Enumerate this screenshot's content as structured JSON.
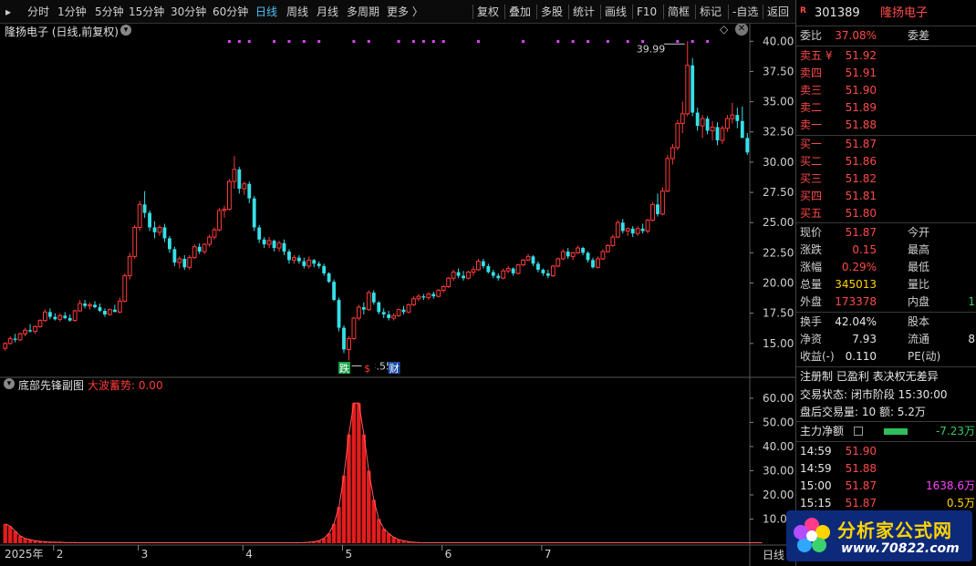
{
  "toolbar": {
    "left": [
      "分时",
      "1分钟",
      "5分钟",
      "15分钟",
      "30分钟",
      "60分钟",
      "日线",
      "周线",
      "月线",
      "多周期",
      "更多 〉"
    ],
    "active": "日线",
    "right": [
      "复权",
      "叠加",
      "多股",
      "统计",
      "画线",
      "F10",
      "简框",
      "标记",
      "-自选",
      "返回"
    ]
  },
  "chart": {
    "title": "隆扬电子 (日线,前复权)",
    "high_label": "39.99",
    "low_label": "13.55",
    "markers": [
      "跌",
      "$",
      "财"
    ],
    "price_ticks": [
      "40.00",
      "37.50",
      "35.00",
      "32.50",
      "30.00",
      "27.50",
      "25.00",
      "22.50",
      "20.00",
      "17.50",
      "15.00"
    ],
    "date_labels": [
      "2025年",
      "2",
      "3",
      "4",
      "5",
      "6",
      "7"
    ],
    "period_label": "日线"
  },
  "sub": {
    "title": "底部先锋副图",
    "series_label": "大波蓄势: 0.00",
    "ticks": [
      "60.00",
      "50.00",
      "40.00",
      "30.00",
      "20.00",
      "10.00"
    ]
  },
  "colors": {
    "up": "#ff3b3b",
    "down": "#35e0e8",
    "grid": "#3a1a1a",
    "bar": "#e41c1c",
    "dot": "#e040fb"
  },
  "chart_data": {
    "type": "candlestick",
    "ylim": [
      12.5,
      41
    ],
    "sub_ylim": [
      0,
      66
    ],
    "candles": [
      [
        14.6,
        15.1,
        14.4,
        15.0
      ],
      [
        15.0,
        15.6,
        14.9,
        15.4
      ],
      [
        15.4,
        15.8,
        15.1,
        15.3
      ],
      [
        15.3,
        15.9,
        15.2,
        15.8
      ],
      [
        15.8,
        16.3,
        15.6,
        16.1
      ],
      [
        16.1,
        16.6,
        15.9,
        16.0
      ],
      [
        16.0,
        16.5,
        15.8,
        16.4
      ],
      [
        16.4,
        17.0,
        16.3,
        16.9
      ],
      [
        16.9,
        17.8,
        16.8,
        17.6
      ],
      [
        17.6,
        17.9,
        17.0,
        17.2
      ],
      [
        17.2,
        17.5,
        16.9,
        17.0
      ],
      [
        17.0,
        17.5,
        16.8,
        17.3
      ],
      [
        17.3,
        17.6,
        17.0,
        17.1
      ],
      [
        17.1,
        17.4,
        16.8,
        16.9
      ],
      [
        16.9,
        17.8,
        16.8,
        17.7
      ],
      [
        17.7,
        18.6,
        17.6,
        18.3
      ],
      [
        18.3,
        18.6,
        17.9,
        18.1
      ],
      [
        18.1,
        18.4,
        17.8,
        18.2
      ],
      [
        18.2,
        18.5,
        17.9,
        18.0
      ],
      [
        18.0,
        18.3,
        17.6,
        17.7
      ],
      [
        17.7,
        17.9,
        17.2,
        17.4
      ],
      [
        17.4,
        17.9,
        17.3,
        17.8
      ],
      [
        17.8,
        18.2,
        17.6,
        17.6
      ],
      [
        17.6,
        18.8,
        17.5,
        18.5
      ],
      [
        18.5,
        20.8,
        18.4,
        20.6
      ],
      [
        20.6,
        22.5,
        20.3,
        22.2
      ],
      [
        22.2,
        24.8,
        22.0,
        24.6
      ],
      [
        24.6,
        26.8,
        24.3,
        26.5
      ],
      [
        26.5,
        27.6,
        25.4,
        25.8
      ],
      [
        25.8,
        26.0,
        24.3,
        24.6
      ],
      [
        24.6,
        25.1,
        23.7,
        24.2
      ],
      [
        24.2,
        24.8,
        23.9,
        24.6
      ],
      [
        24.6,
        24.9,
        23.4,
        23.7
      ],
      [
        23.7,
        23.9,
        22.5,
        22.8
      ],
      [
        22.8,
        23.0,
        21.4,
        21.7
      ],
      [
        21.7,
        22.2,
        21.2,
        22.0
      ],
      [
        22.0,
        22.3,
        21.1,
        21.3
      ],
      [
        21.3,
        22.3,
        21.1,
        22.1
      ],
      [
        22.1,
        23.2,
        22.0,
        23.0
      ],
      [
        23.0,
        23.3,
        22.4,
        22.6
      ],
      [
        22.6,
        23.3,
        22.4,
        23.2
      ],
      [
        23.2,
        24.0,
        23.0,
        23.8
      ],
      [
        23.8,
        24.6,
        23.6,
        24.4
      ],
      [
        24.4,
        26.2,
        24.3,
        26.0
      ],
      [
        26.0,
        26.4,
        25.4,
        26.1
      ],
      [
        26.1,
        28.6,
        26.0,
        28.4
      ],
      [
        28.4,
        30.5,
        27.8,
        29.4
      ],
      [
        29.4,
        29.6,
        27.4,
        27.8
      ],
      [
        27.8,
        28.4,
        27.3,
        28.2
      ],
      [
        28.2,
        28.4,
        26.6,
        27.0
      ],
      [
        27.0,
        27.2,
        24.3,
        24.6
      ],
      [
        24.6,
        24.8,
        23.3,
        23.6
      ],
      [
        23.6,
        23.8,
        22.9,
        23.2
      ],
      [
        23.2,
        23.8,
        22.9,
        23.5
      ],
      [
        23.5,
        23.6,
        22.6,
        22.9
      ],
      [
        22.9,
        23.5,
        22.6,
        23.3
      ],
      [
        23.3,
        23.6,
        22.3,
        22.6
      ],
      [
        22.6,
        22.8,
        21.6,
        21.9
      ],
      [
        21.9,
        22.3,
        21.6,
        22.1
      ],
      [
        22.1,
        22.3,
        21.6,
        21.8
      ],
      [
        21.8,
        22.1,
        21.2,
        21.4
      ],
      [
        21.4,
        22.2,
        21.2,
        21.9
      ],
      [
        21.9,
        22.0,
        21.3,
        21.6
      ],
      [
        21.6,
        21.8,
        21.2,
        21.4
      ],
      [
        21.4,
        21.6,
        20.6,
        20.8
      ],
      [
        20.8,
        20.9,
        20.0,
        20.1
      ],
      [
        20.1,
        20.3,
        18.5,
        18.6
      ],
      [
        18.6,
        18.8,
        16.0,
        16.3
      ],
      [
        16.3,
        16.5,
        14.2,
        14.5
      ],
      [
        14.5,
        15.6,
        13.6,
        15.4
      ],
      [
        15.4,
        17.2,
        15.3,
        17.1
      ],
      [
        17.1,
        18.2,
        16.9,
        18.0
      ],
      [
        18.0,
        18.4,
        17.4,
        17.8
      ],
      [
        17.8,
        19.4,
        17.7,
        19.2
      ],
      [
        19.2,
        19.4,
        18.2,
        18.4
      ],
      [
        18.4,
        18.5,
        17.4,
        17.6
      ],
      [
        17.6,
        17.9,
        17.1,
        17.4
      ],
      [
        17.4,
        17.7,
        16.9,
        17.1
      ],
      [
        17.1,
        17.5,
        16.9,
        17.3
      ],
      [
        17.3,
        17.9,
        17.2,
        17.8
      ],
      [
        17.8,
        18.1,
        17.4,
        17.6
      ],
      [
        17.6,
        18.3,
        17.5,
        18.2
      ],
      [
        18.2,
        18.9,
        18.1,
        18.7
      ],
      [
        18.7,
        19.1,
        18.5,
        18.9
      ],
      [
        18.9,
        19.1,
        18.6,
        18.8
      ],
      [
        18.8,
        19.2,
        18.6,
        19.1
      ],
      [
        19.1,
        19.3,
        18.7,
        18.9
      ],
      [
        18.9,
        19.5,
        18.8,
        19.4
      ],
      [
        19.4,
        19.8,
        19.2,
        19.7
      ],
      [
        19.7,
        20.5,
        19.6,
        20.4
      ],
      [
        20.4,
        21.1,
        20.2,
        20.9
      ],
      [
        20.9,
        21.2,
        20.4,
        20.6
      ],
      [
        20.6,
        21.0,
        20.2,
        20.4
      ],
      [
        20.4,
        21.0,
        20.3,
        20.9
      ],
      [
        20.9,
        21.4,
        20.6,
        21.1
      ],
      [
        21.1,
        22.0,
        21.0,
        21.8
      ],
      [
        21.8,
        22.0,
        21.2,
        21.4
      ],
      [
        21.4,
        21.6,
        20.8,
        20.9
      ],
      [
        20.9,
        21.1,
        20.4,
        20.6
      ],
      [
        20.6,
        20.8,
        20.2,
        20.4
      ],
      [
        20.4,
        21.2,
        20.3,
        21.0
      ],
      [
        21.0,
        21.4,
        20.8,
        21.2
      ],
      [
        21.2,
        21.3,
        20.6,
        20.8
      ],
      [
        20.8,
        21.6,
        20.7,
        21.5
      ],
      [
        21.5,
        22.0,
        21.4,
        21.9
      ],
      [
        21.9,
        22.4,
        21.8,
        22.2
      ],
      [
        22.2,
        22.3,
        21.4,
        21.6
      ],
      [
        21.6,
        21.8,
        20.9,
        21.1
      ],
      [
        21.1,
        21.2,
        20.6,
        20.8
      ],
      [
        20.8,
        21.1,
        20.4,
        20.6
      ],
      [
        20.6,
        21.5,
        20.5,
        21.4
      ],
      [
        21.4,
        22.1,
        21.3,
        22.0
      ],
      [
        22.0,
        22.8,
        21.9,
        22.6
      ],
      [
        22.6,
        22.9,
        22.0,
        22.2
      ],
      [
        22.2,
        22.6,
        21.9,
        22.5
      ],
      [
        22.5,
        23.1,
        22.4,
        22.9
      ],
      [
        22.9,
        23.0,
        22.3,
        22.5
      ],
      [
        22.5,
        22.6,
        21.7,
        21.9
      ],
      [
        21.9,
        22.1,
        21.2,
        21.3
      ],
      [
        21.3,
        22.2,
        21.2,
        22.0
      ],
      [
        22.0,
        22.8,
        21.9,
        22.6
      ],
      [
        22.6,
        23.2,
        22.5,
        23.1
      ],
      [
        23.1,
        24.0,
        23.0,
        23.8
      ],
      [
        23.8,
        25.2,
        23.7,
        25.0
      ],
      [
        25.0,
        25.3,
        24.1,
        24.3
      ],
      [
        24.3,
        24.6,
        23.9,
        24.5
      ],
      [
        24.5,
        24.7,
        23.8,
        24.1
      ],
      [
        24.1,
        24.7,
        23.9,
        24.5
      ],
      [
        24.5,
        24.9,
        24.1,
        24.3
      ],
      [
        24.3,
        25.3,
        24.1,
        25.2
      ],
      [
        25.2,
        26.7,
        25.1,
        26.5
      ],
      [
        26.5,
        27.4,
        25.5,
        25.7
      ],
      [
        25.7,
        27.9,
        25.6,
        27.6
      ],
      [
        27.6,
        30.6,
        27.5,
        30.3
      ],
      [
        30.3,
        31.5,
        29.8,
        31.2
      ],
      [
        31.2,
        33.5,
        31.0,
        33.2
      ],
      [
        33.2,
        35.0,
        32.4,
        34.0
      ],
      [
        34.0,
        40.0,
        33.8,
        38.0
      ],
      [
        38.0,
        38.6,
        33.8,
        34.1
      ],
      [
        34.1,
        34.5,
        32.6,
        33.0
      ],
      [
        33.0,
        33.9,
        32.0,
        33.6
      ],
      [
        33.6,
        33.8,
        32.3,
        32.6
      ],
      [
        32.6,
        33.4,
        31.8,
        32.9
      ],
      [
        32.9,
        33.3,
        31.4,
        31.8
      ],
      [
        31.8,
        33.0,
        31.5,
        32.8
      ],
      [
        32.8,
        33.9,
        32.5,
        33.6
      ],
      [
        33.6,
        34.9,
        33.2,
        33.9
      ],
      [
        33.9,
        34.5,
        32.8,
        33.4
      ],
      [
        33.4,
        34.6,
        33.0,
        32.0
      ],
      [
        32.0,
        32.4,
        30.6,
        30.8
      ]
    ],
    "sub_values": [
      8,
      7,
      5,
      3,
      2,
      1.5,
      1,
      0.8,
      0.6,
      0.5,
      0.4,
      0.4,
      0.3,
      0.3,
      0.3,
      0.2,
      0.2,
      0.2,
      0.2,
      0.2,
      0.2,
      0.2,
      0.2,
      0.2,
      0.2,
      0.2,
      0.2,
      0.2,
      0.2,
      0.2,
      0.2,
      0.2,
      0.2,
      0.2,
      0.2,
      0.2,
      0.2,
      0.2,
      0.2,
      0.2,
      0.2,
      0.2,
      0.2,
      0.2,
      0.2,
      0.2,
      0.2,
      0.2,
      0.2,
      0.2,
      0.2,
      0.2,
      0.2,
      0.2,
      0.2,
      0.2,
      0.2,
      0.2,
      0.2,
      0.2,
      0.3,
      0.4,
      0.6,
      1,
      2,
      4,
      8,
      15,
      28,
      45,
      58,
      58,
      45,
      30,
      18,
      10,
      6,
      4,
      2.5,
      1.5,
      1,
      0.6,
      0.4,
      0.3,
      0.2,
      0.2,
      0.2,
      0.2,
      0.2,
      0.2,
      0.2,
      0.2,
      0.2,
      0.2,
      0.2,
      0.2,
      0.2,
      0.2,
      0.2,
      0.2,
      0.2,
      0.2,
      0.2,
      0.2,
      0.2,
      0.2,
      0.2,
      0.2,
      0.2,
      0.2,
      0.2,
      0.2,
      0.2,
      0.2,
      0.2,
      0.2,
      0.2,
      0.2,
      0.2,
      0.2,
      0.2,
      0.2,
      0.2,
      0.2,
      0.2,
      0.2,
      0.2,
      0.2,
      0.2,
      0.2,
      0.2,
      0.2,
      0.2,
      0.2,
      0.2,
      0.2,
      0.2,
      0.2,
      0.2,
      0.2,
      0.2,
      0.2,
      0.2,
      0.2,
      0.2,
      0.2,
      0.2,
      0.2,
      0.2,
      0.2,
      0.2,
      0.2,
      0.2
    ]
  },
  "panel": {
    "code": "301389",
    "name": "隆扬电子",
    "r_badge": "R",
    "weibi_label": "委比",
    "weibi_value": "37.08%",
    "weicha_label": "委差",
    "asks": [
      {
        "label": "卖五 ¥",
        "price": "51.92"
      },
      {
        "label": "卖四",
        "price": "51.91"
      },
      {
        "label": "卖三",
        "price": "51.90"
      },
      {
        "label": "卖二",
        "price": "51.89"
      },
      {
        "label": "卖一",
        "price": "51.88"
      }
    ],
    "bids": [
      {
        "label": "买一",
        "price": "51.87"
      },
      {
        "label": "买二",
        "price": "51.86"
      },
      {
        "label": "买三",
        "price": "51.82"
      },
      {
        "label": "买四",
        "price": "51.81"
      },
      {
        "label": "买五",
        "price": "51.80"
      }
    ],
    "quote": [
      {
        "l1": "现价",
        "v1": "51.87",
        "c1": "red",
        "l2": "今开",
        "v2": ""
      },
      {
        "l1": "涨跌",
        "v1": "0.15",
        "c1": "red",
        "l2": "最高",
        "v2": ""
      },
      {
        "l1": "涨幅",
        "v1": "0.29%",
        "c1": "red",
        "l2": "最低",
        "v2": ""
      },
      {
        "l1": "总量",
        "v1": "345013",
        "c1": "yellow",
        "l2": "量比",
        "v2": ""
      },
      {
        "l1": "外盘",
        "v1": "173378",
        "c1": "red",
        "l2": "内盘",
        "v2": "1"
      }
    ],
    "stats": [
      {
        "l1": "换手",
        "v1": "42.04%",
        "l2": "股本",
        "v2": ""
      },
      {
        "l1": "净资",
        "v1": "7.93",
        "l2": "流通",
        "v2": "8"
      },
      {
        "l1": "收益(-)",
        "v1": "0.110",
        "l2": "PE(动)",
        "v2": ""
      }
    ],
    "tags": "注册制  已盈利  表决权无差异",
    "trade_status": "交易状态: 闭市阶段 15:30:00",
    "after_hours": "盘后交易量: 10  额: 5.2万",
    "main_flow_label": "主力净额",
    "main_flow_value": "-7.23万",
    "ticks": [
      {
        "time": "14:59",
        "price": "51.90",
        "vol": ""
      },
      {
        "time": "14:59",
        "price": "51.88",
        "vol": ""
      },
      {
        "time": "15:00",
        "price": "51.87",
        "vol": "1638.6万"
      },
      {
        "time": "15:15",
        "price": "51.87",
        "vol": "0.5万"
      }
    ]
  },
  "watermark": {
    "title": "分析家公式网",
    "url": "www.70822.com"
  }
}
